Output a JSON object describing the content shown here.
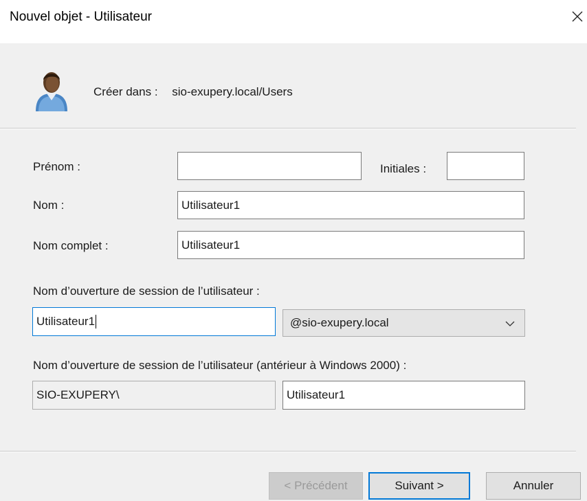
{
  "window": {
    "title": "Nouvel objet - Utilisateur",
    "close_icon": "close-icon"
  },
  "header": {
    "icon": "user-icon",
    "create_in_label": "Créer dans :",
    "create_in_path": "sio-exupery.local/Users"
  },
  "form": {
    "first_name": {
      "label": "Prénom :",
      "value": ""
    },
    "initials": {
      "label": "Initiales :",
      "value": ""
    },
    "last_name": {
      "label": "Nom :",
      "value": "Utilisateur1"
    },
    "full_name": {
      "label": "Nom complet :",
      "value": "Utilisateur1"
    },
    "logon_name": {
      "label": "Nom d’ouverture de session de l’utilisateur :",
      "value": "Utilisateur1",
      "domain_selected": "@sio-exupery.local"
    },
    "pre2000_logon": {
      "label": "Nom d’ouverture de session de l’utilisateur (antérieur à Windows 2000) :",
      "domain_prefix": "SIO-EXUPERY\\",
      "value": "Utilisateur1"
    }
  },
  "footer": {
    "back_label": "< Précédent",
    "next_label": "Suivant >",
    "cancel_label": "Annuler"
  },
  "colors": {
    "panel_bg": "#f0f0f0",
    "focus_border": "#0078d7",
    "button_bg": "#e1e1e1"
  }
}
